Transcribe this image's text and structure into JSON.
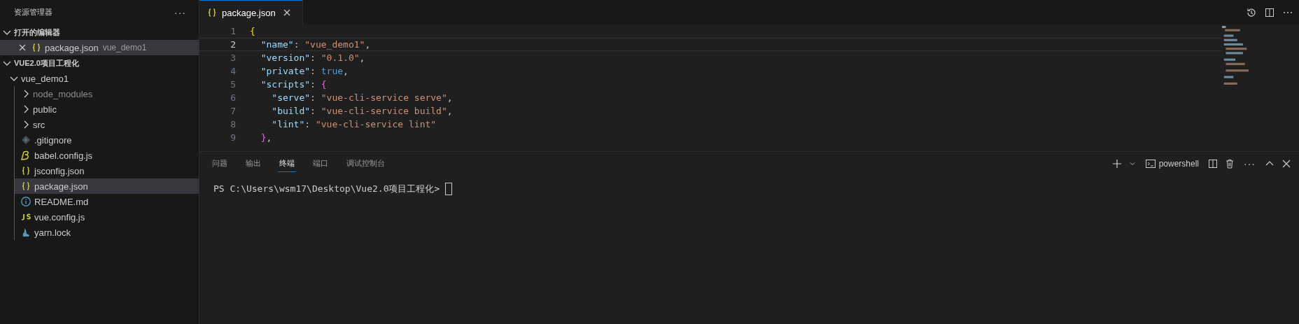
{
  "sidebar": {
    "title": "资源管理器",
    "more": "···",
    "sections": [
      {
        "title": "打开的编辑器",
        "expanded": true,
        "kind": "editors",
        "items": [
          {
            "name": "package.json",
            "description": "vue_demo1",
            "kind": "json",
            "selected": true
          }
        ]
      },
      {
        "title": "VUE2.0项目工程化",
        "expanded": true,
        "kind": "tree",
        "items": [
          {
            "name": "vue_demo1",
            "expanded": true,
            "children": [
              {
                "name": "node_modules",
                "kind": "folder",
                "expanded": false,
                "selected": false,
                "dimmed": true
              },
              {
                "name": "public",
                "kind": "folder",
                "expanded": false,
                "selected": false,
                "dimmed": false
              },
              {
                "name": "src",
                "kind": "folder",
                "expanded": false,
                "selected": false,
                "dimmed": false
              },
              {
                "name": ".gitignore",
                "kind": "git",
                "selected": false,
                "dimmed": false
              },
              {
                "name": "babel.config.js",
                "kind": "babel",
                "selected": false,
                "dimmed": false
              },
              {
                "name": "jsconfig.json",
                "kind": "json",
                "selected": false,
                "dimmed": false
              },
              {
                "name": "package.json",
                "kind": "json",
                "selected": true,
                "dimmed": false
              },
              {
                "name": "README.md",
                "kind": "info",
                "selected": false,
                "dimmed": false
              },
              {
                "name": "vue.config.js",
                "kind": "js",
                "selected": false,
                "dimmed": false
              },
              {
                "name": "yarn.lock",
                "kind": "yarn",
                "selected": false,
                "dimmed": false
              }
            ]
          }
        ]
      }
    ]
  },
  "editor": {
    "tabs": [
      {
        "label": "package.json",
        "kind": "json",
        "selected": true
      }
    ],
    "lines": [
      {
        "number": "1",
        "current": false,
        "tokens": [
          {
            "kind": "brace1",
            "text": "{"
          }
        ]
      },
      {
        "number": "2",
        "current": true,
        "tokens": [
          {
            "kind": "key",
            "text": "  \"name\""
          },
          {
            "kind": "punct",
            "text": ": "
          },
          {
            "kind": "string",
            "text": "\"vue_demo1\""
          },
          {
            "kind": "punct",
            "text": ","
          }
        ]
      },
      {
        "number": "3",
        "current": false,
        "tokens": [
          {
            "kind": "key",
            "text": "  \"version\""
          },
          {
            "kind": "punct",
            "text": ": "
          },
          {
            "kind": "string",
            "text": "\"0.1.0\""
          },
          {
            "kind": "punct",
            "text": ","
          }
        ]
      },
      {
        "number": "4",
        "current": false,
        "tokens": [
          {
            "kind": "key",
            "text": "  \"private\""
          },
          {
            "kind": "punct",
            "text": ": "
          },
          {
            "kind": "bool",
            "text": "true"
          },
          {
            "kind": "punct",
            "text": ","
          }
        ]
      },
      {
        "number": "5",
        "current": false,
        "tokens": [
          {
            "kind": "key",
            "text": "  \"scripts\""
          },
          {
            "kind": "punct",
            "text": ": "
          },
          {
            "kind": "brace2",
            "text": "{"
          }
        ]
      },
      {
        "number": "6",
        "current": false,
        "tokens": [
          {
            "kind": "key",
            "text": "    \"serve\""
          },
          {
            "kind": "punct",
            "text": ": "
          },
          {
            "kind": "string",
            "text": "\"vue-cli-service serve\""
          },
          {
            "kind": "punct",
            "text": ","
          }
        ]
      },
      {
        "number": "7",
        "current": false,
        "tokens": [
          {
            "kind": "key",
            "text": "    \"build\""
          },
          {
            "kind": "punct",
            "text": ": "
          },
          {
            "kind": "string",
            "text": "\"vue-cli-service build\""
          },
          {
            "kind": "punct",
            "text": ","
          }
        ]
      },
      {
        "number": "8",
        "current": false,
        "tokens": [
          {
            "kind": "key",
            "text": "    \"lint\""
          },
          {
            "kind": "punct",
            "text": ": "
          },
          {
            "kind": "string",
            "text": "\"vue-cli-service lint\""
          }
        ]
      },
      {
        "number": "9",
        "current": false,
        "tokens": [
          {
            "kind": "brace2",
            "text": "  }"
          },
          {
            "kind": "punct",
            "text": ","
          }
        ]
      }
    ]
  },
  "panel": {
    "tabs": [
      {
        "label": "问题",
        "selected": false
      },
      {
        "label": "输出",
        "selected": false
      },
      {
        "label": "终端",
        "selected": true
      },
      {
        "label": "端口",
        "selected": false
      },
      {
        "label": "调试控制台",
        "selected": false
      }
    ],
    "terminal_name": "powershell",
    "more": "···",
    "terminal_lines": [
      "PS C:\\Users\\wsm17\\Desktop\\Vue2.0项目工程化> "
    ]
  }
}
